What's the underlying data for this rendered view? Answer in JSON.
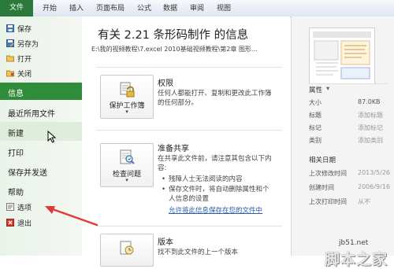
{
  "ribbon": {
    "tabs": [
      "文件",
      "开始",
      "插入",
      "页面布局",
      "公式",
      "数据",
      "审阅",
      "视图"
    ]
  },
  "sidebar": {
    "items": [
      {
        "label": "保存",
        "icon": "save-icon"
      },
      {
        "label": "另存为",
        "icon": "save-as-icon"
      },
      {
        "label": "打开",
        "icon": "open-folder-icon"
      },
      {
        "label": "关闭",
        "icon": "close-file-icon"
      },
      {
        "label": "信息"
      },
      {
        "label": "最近所用文件"
      },
      {
        "label": "新建"
      },
      {
        "label": "打印"
      },
      {
        "label": "保存并发送"
      },
      {
        "label": "帮助"
      },
      {
        "label": "选项",
        "icon": "options-icon"
      },
      {
        "label": "退出",
        "icon": "exit-icon"
      }
    ]
  },
  "info": {
    "title": "有关 2.21 条形码制作 的信息",
    "path": "E:\\我的视频教程\\7.excel 2010基础视频教程\\第2章 图形..."
  },
  "sections": {
    "permissions": {
      "button": "保护工作簿",
      "title": "权限",
      "lines": [
        "任何人都能打开、复制和更改此工作簿",
        "的任何部分。"
      ]
    },
    "prepare": {
      "button": "检查问题",
      "title": "准备共享",
      "lines": [
        "在共享此文件前，请注意其包含以下内",
        "容:"
      ],
      "bullets": [
        "残障人士无法阅读的内容",
        "保存文件时，将自动删除属性和个",
        "人信息的设置"
      ],
      "link": "允许将此信息保存在您的文件中"
    },
    "versions": {
      "title": "版本",
      "line": "找不到此文件的上一个版本"
    }
  },
  "properties": {
    "header": "属性",
    "rows": [
      {
        "k": "大小",
        "v": "87.0KB"
      },
      {
        "k": "标题",
        "v": "添加标题"
      },
      {
        "k": "标记",
        "v": "添加标记"
      },
      {
        "k": "类别",
        "v": "添加类别"
      }
    ],
    "dates_header": "相关日期",
    "dates": [
      {
        "k": "上次修改时间",
        "v": "2013/5/26"
      },
      {
        "k": "创建时间",
        "v": "2006/9/16"
      },
      {
        "k": "上次打印时间",
        "v": "从不"
      }
    ]
  },
  "watermark": {
    "big": "脚本之家",
    "url": "jb51.net"
  },
  "colors": {
    "file_tab": "#2a7a3c",
    "selected": "#2f8c3b",
    "arrow": "#e23a3a"
  }
}
